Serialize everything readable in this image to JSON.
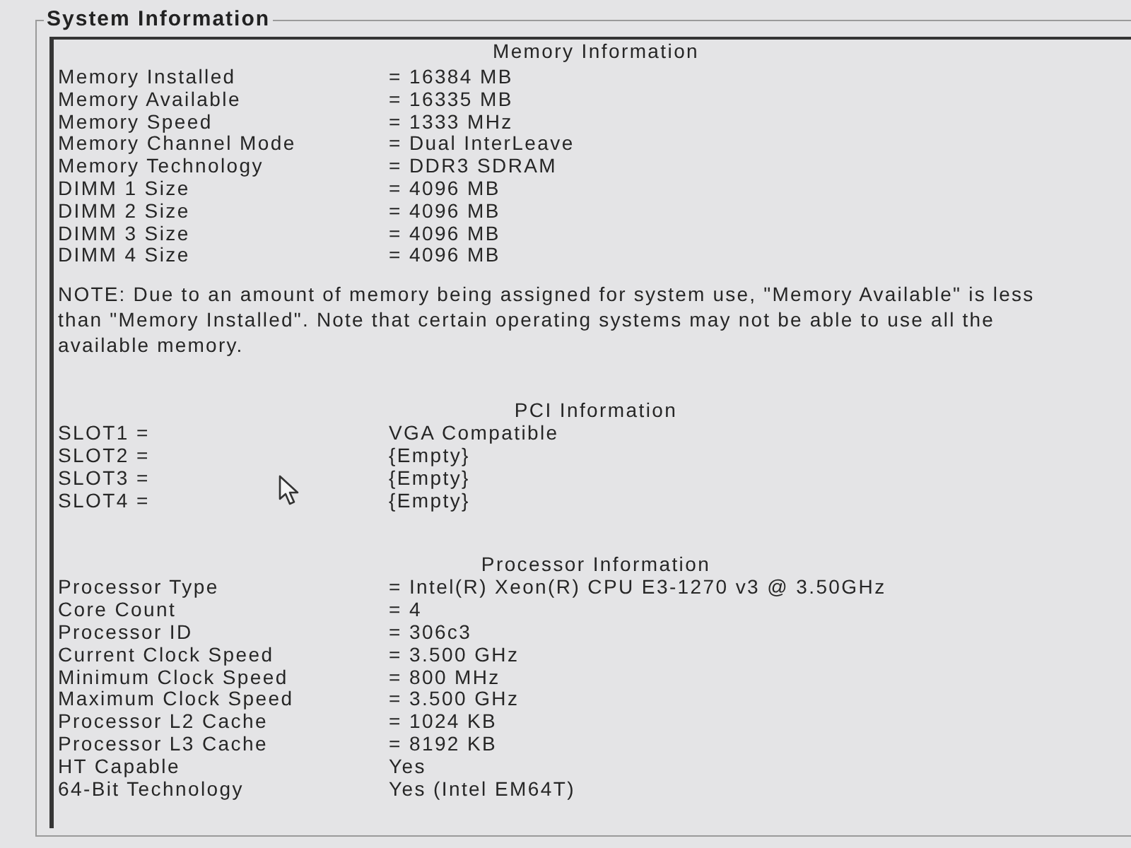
{
  "group_title": "System Information",
  "sections": [
    {
      "kind": "table",
      "title": "Memory Information",
      "rows": [
        {
          "label": "Memory Installed",
          "value": "= 16384 MB"
        },
        {
          "label": "Memory Available",
          "value": "= 16335 MB"
        },
        {
          "label": "Memory Speed",
          "value": "= 1333 MHz"
        },
        {
          "label": "Memory Channel Mode",
          "value": "= Dual InterLeave"
        },
        {
          "label": "Memory Technology",
          "value": "= DDR3 SDRAM"
        },
        {
          "label": "DIMM 1 Size",
          "value": "= 4096 MB"
        },
        {
          "label": "DIMM 2 Size",
          "value": "= 4096 MB"
        },
        {
          "label": "DIMM 3 Size",
          "value": "= 4096 MB"
        },
        {
          "label": "DIMM 4 Size",
          "value": "= 4096 MB"
        }
      ]
    },
    {
      "kind": "note",
      "text": "NOTE: Due to an amount of memory being assigned for system use, \"Memory Available\" is less than \"Memory Installed\". Note that certain operating systems may not be able to use all the available memory."
    },
    {
      "kind": "table",
      "title": "PCI Information",
      "rows": [
        {
          "label": "SLOT1 =",
          "value": "VGA Compatible"
        },
        {
          "label": "SLOT2 =",
          "value": "{Empty}"
        },
        {
          "label": "SLOT3 =",
          "value": "{Empty}"
        },
        {
          "label": "SLOT4 =",
          "value": "{Empty}"
        }
      ]
    },
    {
      "kind": "table",
      "title": "Processor Information",
      "rows": [
        {
          "label": "Processor Type",
          "value": "= Intel(R) Xeon(R) CPU E3-1270 v3 @ 3.50GHz"
        },
        {
          "label": "Core Count",
          "value": "= 4"
        },
        {
          "label": "Processor ID",
          "value": "= 306c3"
        },
        {
          "label": "Current Clock Speed",
          "value": "= 3.500 GHz"
        },
        {
          "label": "Minimum Clock Speed",
          "value": "= 800 MHz"
        },
        {
          "label": "Maximum Clock Speed",
          "value": "= 3.500 GHz"
        },
        {
          "label": "Processor L2 Cache",
          "value": "= 1024 KB"
        },
        {
          "label": "Processor L3 Cache",
          "value": "= 8192 KB"
        },
        {
          "label": "HT Capable",
          "value": "Yes"
        },
        {
          "label": "64-Bit Technology",
          "value": "Yes (Intel EM64T)"
        }
      ]
    }
  ]
}
